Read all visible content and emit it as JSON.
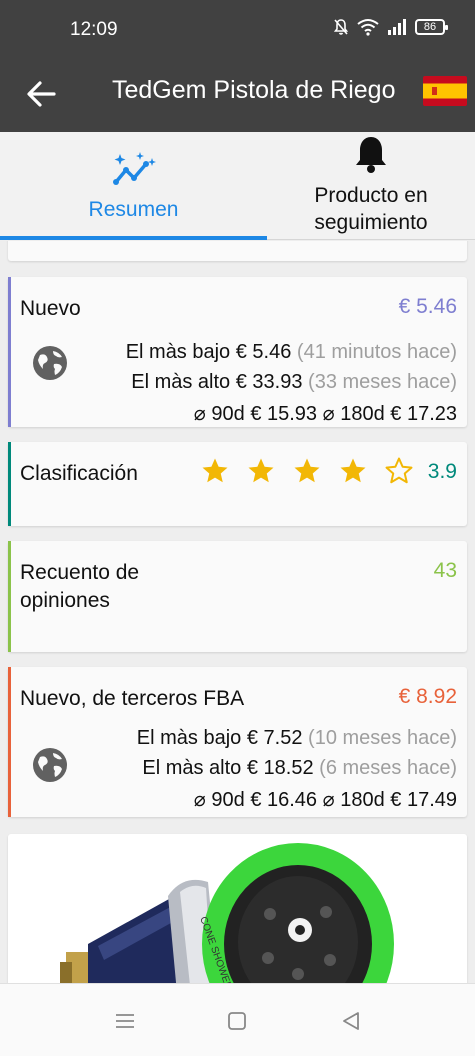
{
  "status_bar": {
    "time": "12:09",
    "battery": "86",
    "icons": [
      "mute-icon",
      "wifi-icon",
      "signal-icon",
      "battery-icon"
    ]
  },
  "app_bar": {
    "title": "TedGem Pistola de Riego",
    "back_icon": "arrow-left-icon",
    "flag_icon": "spain-flag-icon"
  },
  "tabs": [
    {
      "label": "Resumen",
      "icon": "trend-sparkle-icon",
      "active": true
    },
    {
      "label": "Producto en seguimiento",
      "icon": "bell-icon",
      "active": false
    }
  ],
  "cards": {
    "nuevo": {
      "label": "Nuevo",
      "value": "€ 5.46",
      "accent_color": "#7e7ed0",
      "lowest_label": "El màs bajo",
      "lowest_value": "€ 5.46",
      "lowest_when": "(41 minutos hace)",
      "highest_label": "El màs alto",
      "highest_value": "€ 33.93",
      "highest_when": "(33 meses hace)",
      "avg90_label": "⌀ 90d",
      "avg90_value": "€ 15.93",
      "avg180_label": "⌀ 180d",
      "avg180_value": "€ 17.23"
    },
    "rating": {
      "label": "Clasificación",
      "value": "3.9",
      "stars_filled": 4,
      "stars_total": 5,
      "accent_color": "#00897b"
    },
    "reviews": {
      "label": "Recuento de opiniones",
      "value": "43",
      "accent_color": "#8bc34a"
    },
    "fba": {
      "label": "Nuevo, de terceros FBA",
      "value": "€ 8.92",
      "accent_color": "#e8623a",
      "lowest_label": "El màs bajo",
      "lowest_value": "€ 7.52",
      "lowest_when": "(10 meses hace)",
      "highest_label": "El màs alto",
      "highest_value": "€ 18.52",
      "highest_when": "(6 meses hace)",
      "avg90_label": "⌀ 90d",
      "avg90_value": "€ 16.46",
      "avg180_label": "⌀ 180d",
      "avg180_value": "€ 17.49"
    }
  },
  "product_image_text": "CONE SHOWER",
  "nav_bar": [
    "menu-icon",
    "home-square-icon",
    "back-triangle-icon"
  ],
  "colors": {
    "primary": "#1e88e5",
    "bar": "#414141",
    "star": "#f2b705",
    "muted": "#9e9e9e",
    "nuevo_price": "#7e7ed0",
    "rating_value": "#00897b",
    "reviews_value": "#8bc34a",
    "fba_price": "#e8623a"
  }
}
